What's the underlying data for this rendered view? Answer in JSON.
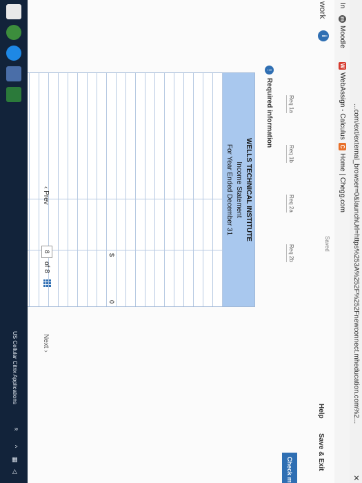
{
  "browser": {
    "url": "...com/ext/external_browser=0&launchUrl=https%253A%252F%252Fnewconnect.mheducation.com%2...",
    "bookmarks": [
      {
        "label": "In",
        "icon": ""
      },
      {
        "label": "Moodle",
        "icon": "moodle-icon"
      },
      {
        "label": "WebAssign - Calculus",
        "icon": "webassign-icon"
      },
      {
        "label": "Home | Chegg.com",
        "icon": "chegg-icon"
      }
    ]
  },
  "header": {
    "title": "work",
    "info_badge": "i",
    "saved": "Saved",
    "help": "Help",
    "save_exit": "Save & Exit",
    "check_my": "Check my"
  },
  "tabs": [
    "Req 1a",
    "Req 1b",
    "Req 2a",
    "Req 2b"
  ],
  "required_info": {
    "badge": "!",
    "text": "Required information"
  },
  "statement": {
    "company": "WELLS TECHNICAL INSTITUTE",
    "title": "Income Statement",
    "period": "For Year Ended December 31",
    "total_currency": "$",
    "total_value": "0"
  },
  "pager": {
    "prev": "Prev",
    "current": "8",
    "of": "of 8",
    "next": "Next"
  },
  "taskbar": {
    "status": "US Cellular Citrix Applications"
  }
}
